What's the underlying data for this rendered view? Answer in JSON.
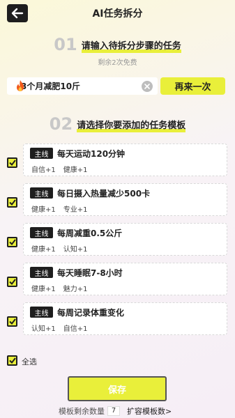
{
  "header": {
    "title": "AI任务拆分",
    "back_icon": "arrow-left-icon"
  },
  "step1": {
    "num": "01",
    "title": "请输入待拆分步骤的任务",
    "remaining": "剩余2次免费"
  },
  "input": {
    "value": "3个月减肥10斤",
    "fire_icon": "fire-icon",
    "clear_icon": "close-circle-icon"
  },
  "again_button": "再来一次",
  "step2": {
    "num": "02",
    "title": "请选择你要添加的任务模板"
  },
  "tasks": [
    {
      "badge": "主线",
      "title": "每天运动120分钟",
      "tags": [
        "自信+1",
        "健康+1"
      ],
      "checked": true
    },
    {
      "badge": "主线",
      "title": "每日摄入热量减少500卡",
      "tags": [
        "健康+1",
        "专业+1"
      ],
      "checked": true
    },
    {
      "badge": "主线",
      "title": "每周减重0.5公斤",
      "tags": [
        "健康+1",
        "认知+1"
      ],
      "checked": true
    },
    {
      "badge": "主线",
      "title": "每天睡眠7-8小时",
      "tags": [
        "健康+1",
        "魅力+1"
      ],
      "checked": true
    },
    {
      "badge": "主线",
      "title": "每周记录体重变化",
      "tags": [
        "认知+1",
        "自信+1"
      ],
      "checked": true
    }
  ],
  "select_all": {
    "label": "全选",
    "checked": true
  },
  "save_button": "保存",
  "footer": {
    "remaining_label": "模板剩余数量",
    "remaining_count": "7",
    "expand_link": "扩容模板数>"
  },
  "colors": {
    "accent": "#e9ef3a",
    "dark": "#1e1e1e"
  }
}
